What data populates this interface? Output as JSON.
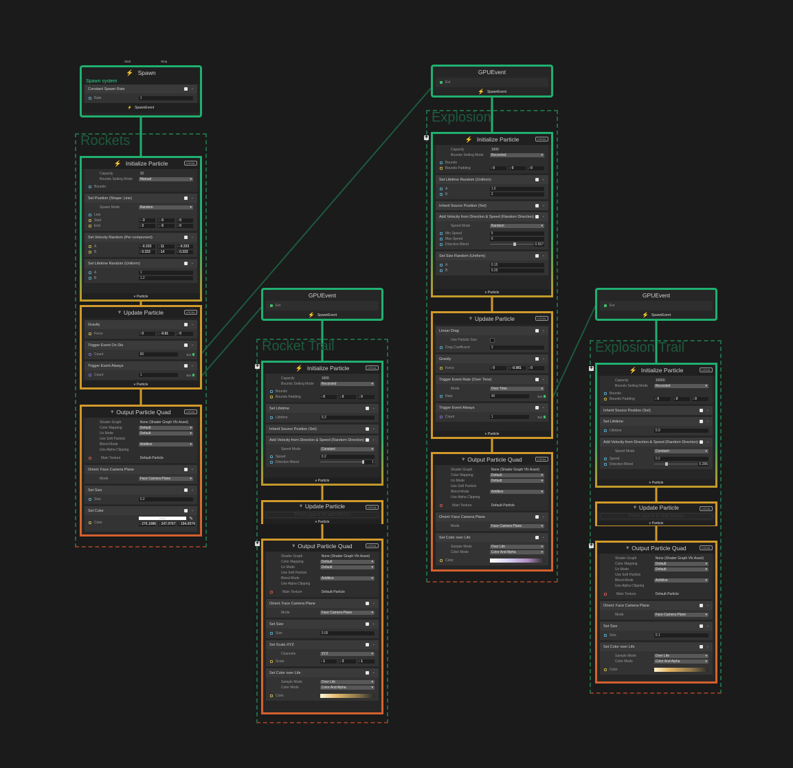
{
  "colors": {
    "background": "#1b1b1b",
    "spawn_green": "#20b070",
    "update_yellow": "#d19a2a",
    "output_orange": "#d4602e",
    "group_border": "#1f6a45"
  },
  "spawn": {
    "title": "Spawn",
    "subtitle": "Spawn system",
    "start_label": "Start",
    "stop_label": "Stop",
    "block_title": "Constant Spawn Rate",
    "rate_label": "Rate",
    "rate_value": "1",
    "footer": "SpawnEvent"
  },
  "groups": {
    "rockets": "Rockets",
    "rocket_trail": "Rocket Trail",
    "explosion": "Explosion",
    "explosion_trail": "Explosion Trail"
  },
  "badges": {
    "space": "LOCAL",
    "placeholder": "Press space to add blocks",
    "particle": "Particle"
  },
  "rockets": {
    "init": {
      "title": "Initialize Particle",
      "capacity_label": "Capacity",
      "capacity": "32",
      "bounds_mode_label": "Bounds Setting Mode",
      "bounds_mode": "Manual",
      "bounds_label": "Bounds",
      "set_position": {
        "title": "Set Position (Shape: Line)",
        "spawn_mode_label": "Spawn Mode",
        "spawn_mode": "Random",
        "line_label": "Line",
        "start_label": "Start",
        "end_label": "End",
        "start": [
          "-3",
          "-5",
          "0"
        ],
        "end": [
          "3",
          "-5",
          "0"
        ]
      },
      "set_velocity": {
        "title": "Set Velocity Random (Per-component)",
        "a_label": "A",
        "b_label": "B",
        "a": [
          "-0.333",
          "11",
          "-0.333"
        ],
        "b": [
          "0.333",
          "14",
          "0.333"
        ]
      },
      "set_lifetime": {
        "title": "Set Lifetime Random (Uniform)",
        "a_label": "A",
        "b_label": "B",
        "a": "1",
        "b": "1.2"
      }
    },
    "update": {
      "title": "Update Particle",
      "gravity": {
        "title": "Gravity",
        "force_label": "Force",
        "force": [
          "0",
          "-9.81",
          "0"
        ]
      },
      "trigger_die": {
        "title": "Trigger Event On Die",
        "count_label": "Count",
        "count": "80",
        "evt": "Evt"
      },
      "trigger_always": {
        "title": "Trigger Event Always",
        "count_label": "Count",
        "count": "1",
        "evt": "Evt"
      }
    },
    "output": {
      "title": "Output Particle Quad",
      "shader_graph_label": "Shader Graph",
      "shader_graph": "None (Shader Graph Vfx Asset)",
      "color_mapping_label": "Color Mapping",
      "color_mapping": "Default",
      "uv_mode_label": "Uv Mode",
      "uv_mode": "Default",
      "soft_label": "Use Soft Particle",
      "blend_label": "Blend Mode",
      "blend": "Additive",
      "alpha_clip_label": "Use Alpha Clipping",
      "main_tex_label": "Main Texture",
      "main_tex": "Default-Particle",
      "orient": {
        "title": "Orient: Face Camera Plane",
        "mode_label": "Mode",
        "mode": "Face Camera Plane"
      },
      "set_size": {
        "title": "Set Size",
        "size_label": "Size",
        "size": "0.2"
      },
      "set_color": {
        "title": "Set Color",
        "color_label": "Color",
        "hdr": "HDR",
        "rgb": [
          "276.1086",
          "247.9767",
          "194.0574"
        ]
      }
    }
  },
  "rocket_trail": {
    "gpu_event": {
      "title": "GPUEvent",
      "evt": "Evt",
      "footer": "SpawnEvent"
    },
    "init": {
      "title": "Initialize Particle",
      "capacity_label": "Capacity",
      "capacity": "1000",
      "bounds_mode_label": "Bounds Setting Mode",
      "bounds_mode": "Recorded",
      "bounds_label": "Bounds",
      "padding_label": "Bounds Padding",
      "padding": [
        "0",
        "0",
        "0"
      ],
      "set_lifetime": {
        "title": "Set Lifetime",
        "lifetime_label": "Lifetime",
        "lifetime": "0.3"
      },
      "inherit": {
        "title": "Inherit Source Position (Set)"
      },
      "add_velocity": {
        "title": "Add Velocity from Direction & Speed (Random Direction)",
        "speed_mode_label": "Speed Mode",
        "speed_mode": "Constant",
        "speed_label": "Speed",
        "speed": "0.2",
        "blend_label": "Direction Blend",
        "blend": "1",
        "blend_fraction": 1.0
      }
    },
    "update": {
      "title": "Update Particle"
    },
    "output": {
      "title": "Output Particle Quad",
      "shader_graph": "None (Shader Graph Vfx Asset)",
      "color_mapping": "Default",
      "uv_mode": "Default",
      "blend": "Additive",
      "main_tex": "Default-Particle",
      "orient": {
        "title": "Orient: Face Camera Plane",
        "mode": "Face Camera Plane"
      },
      "set_size": {
        "title": "Set Size",
        "size": "0.05"
      },
      "set_scale": {
        "title": "Set Scale.XYZ",
        "channels_label": "Channels",
        "channels": "XYZ",
        "scale_label": "Scale",
        "scale": [
          "1",
          "3",
          "1"
        ]
      },
      "color_life": {
        "title": "Set Color over Life",
        "sample_label": "Sample Mode",
        "sample": "Over Life",
        "color_mode_label": "Color Mode",
        "color_mode": "Color And Alpha",
        "color_label": "Color"
      }
    }
  },
  "explosion": {
    "gpu_event": {
      "title": "GPUEvent",
      "evt": "Evt",
      "footer": "SpawnEvent"
    },
    "init": {
      "title": "Initialize Particle",
      "capacity": "1000",
      "bounds_mode": "Recorded",
      "padding": [
        "0",
        "0",
        "0"
      ],
      "set_lifetime": {
        "title": "Set Lifetime Random (Uniform)",
        "a": "1.5",
        "b": "2"
      },
      "inherit": {
        "title": "Inherit Source Position (Set)"
      },
      "add_velocity": {
        "title": "Add Velocity from Direction & Speed (Random Direction)",
        "speed_mode": "Random",
        "min_label": "Min Speed",
        "min": "5",
        "max_label": "Max Speed",
        "max": "6",
        "blend_label": "Direction Blend",
        "blend": "0.567",
        "blend_fraction": 0.567
      },
      "set_size": {
        "title": "Set Size Random (Uniform)",
        "a": "0.15",
        "b": "0.25"
      }
    },
    "update": {
      "title": "Update Particle",
      "drag": {
        "title": "Linear Drag",
        "use_size_label": "Use Particle Size",
        "coef_label": "Drag Coefficient",
        "coef": "3"
      },
      "gravity": {
        "title": "Gravity",
        "force": [
          "0",
          "-0.981",
          "0"
        ]
      },
      "trigger_rate": {
        "title": "Trigger Event Rate (Over Time)",
        "mode_label": "Mode",
        "mode": "Over Time",
        "rate_label": "Rate",
        "rate": "40"
      },
      "trigger_always": {
        "title": "Trigger Event Always",
        "count": "1"
      }
    },
    "output": {
      "title": "Output Particle Quad",
      "shader_graph": "None (Shader Graph Vfx Asset)",
      "color_mapping": "Default",
      "uv_mode": "Default",
      "blend": "Additive",
      "main_tex": "Default-Particle",
      "orient": {
        "title": "Orient: Face Camera Plane",
        "mode": "Face Camera Plane"
      },
      "color_life": {
        "title": "Set Color over Life",
        "sample": "Over Life",
        "color_mode": "Color And Alpha"
      }
    }
  },
  "explosion_trail": {
    "gpu_event": {
      "title": "GPUEvent",
      "evt": "Evt",
      "footer": "SpawnEvent"
    },
    "init": {
      "title": "Initialize Particle",
      "capacity": "10000",
      "bounds_mode": "Recorded",
      "padding": [
        "0",
        "0",
        "0"
      ],
      "inherit": {
        "title": "Inherit Source Position (Set)"
      },
      "set_lifetime": {
        "title": "Set Lifetime",
        "lifetime": "0.9"
      },
      "add_velocity": {
        "title": "Add Velocity from Direction & Speed (Random Direction)",
        "speed_mode": "Constant",
        "speed": "0.2",
        "blend": "0.286",
        "blend_fraction": 0.286
      }
    },
    "update": {
      "title": "Update Particle"
    },
    "output": {
      "title": "Output Particle Quad",
      "shader_graph": "None (Shader Graph Vfx Asset)",
      "color_mapping": "Default",
      "uv_mode": "Default",
      "blend": "Additive",
      "main_tex": "Default-Particle",
      "orient": {
        "title": "Orient: Face Camera Plane",
        "mode": "Face Camera Plane"
      },
      "set_size": {
        "title": "Set Size",
        "size": "0.1"
      },
      "color_life": {
        "title": "Set Color over Life",
        "sample": "Over Life",
        "color_mode": "Color And Alpha"
      }
    }
  }
}
